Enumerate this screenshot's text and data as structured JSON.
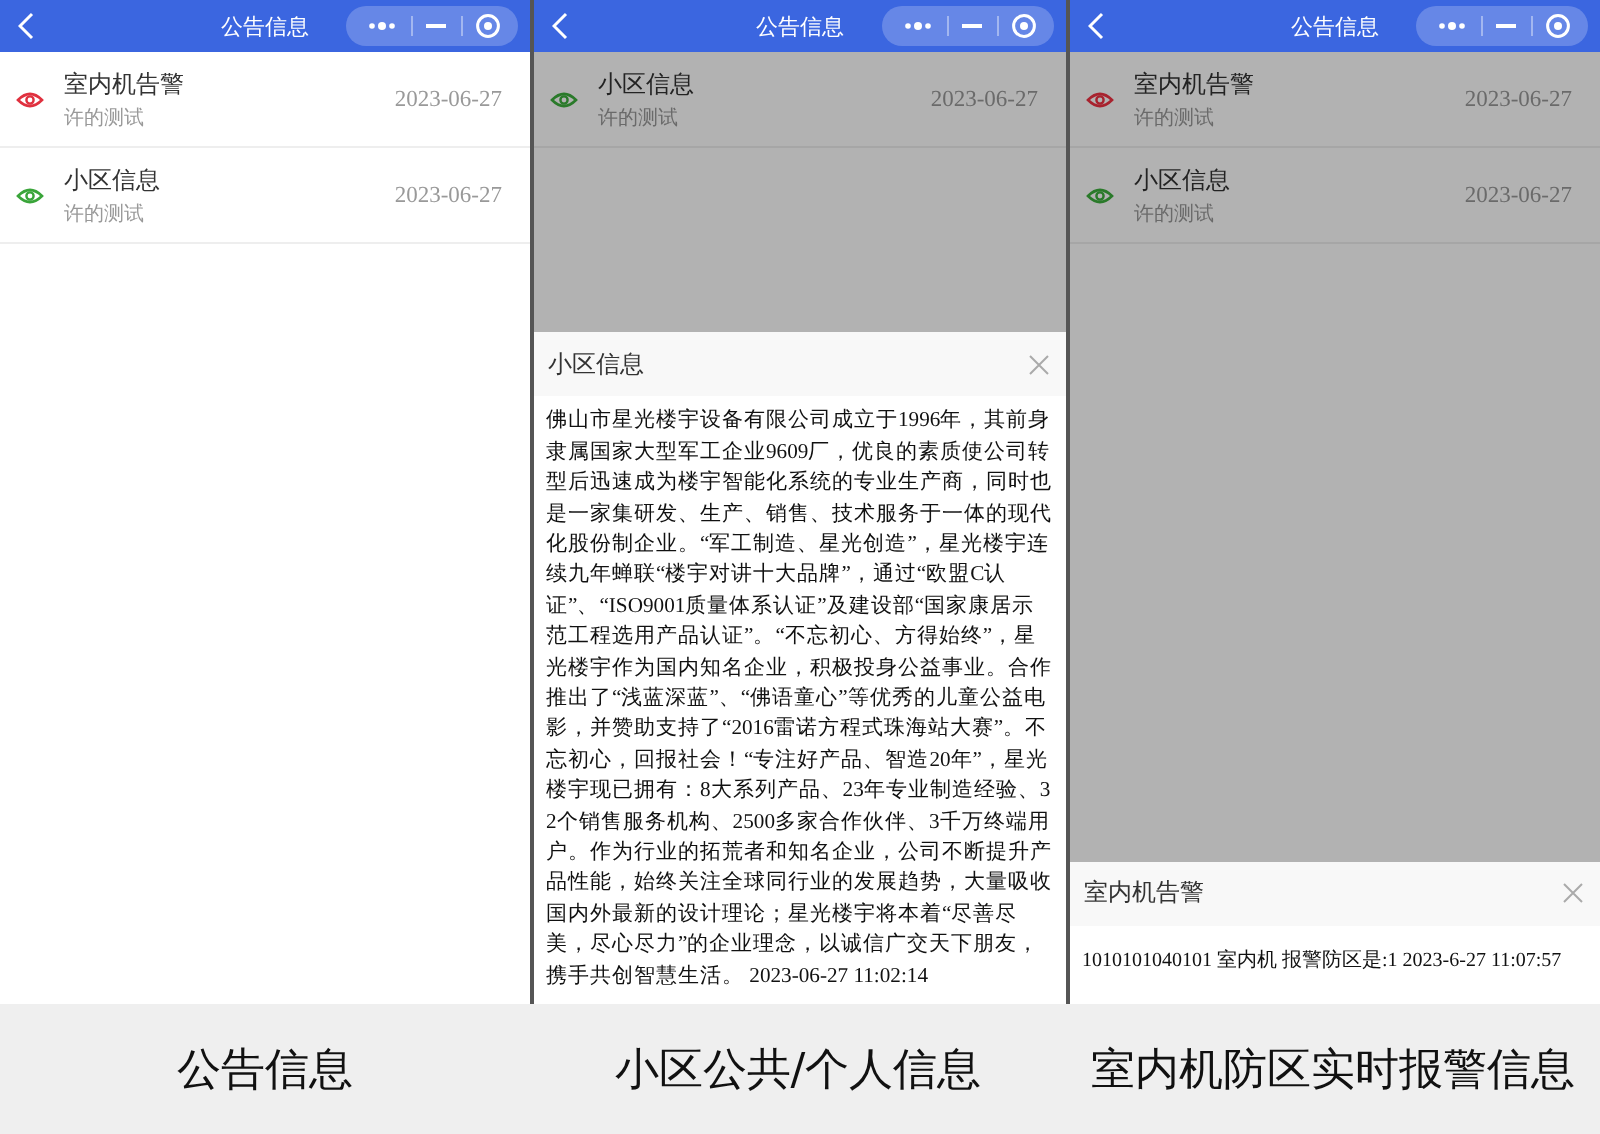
{
  "panels": [
    {
      "title": "公告信息",
      "items": [
        {
          "title": "室内机告警",
          "subtitle": "许的测试",
          "date": "2023-06-27",
          "color": "#e0313f"
        },
        {
          "title": "小区信息",
          "subtitle": "许的测试",
          "date": "2023-06-27",
          "color": "#3aa53a"
        }
      ],
      "caption": "公告信息"
    },
    {
      "title": "公告信息",
      "items": [
        {
          "title": "小区信息",
          "subtitle": "许的测试",
          "date": "2023-06-27",
          "color": "#2a7a2a"
        }
      ],
      "dialog": {
        "title": "小区信息",
        "body": "佛山市星光楼宇设备有限公司成立于1996年，其前身隶属国家大型军工企业9609厂，优良的素质使公司转型后迅速成为楼宇智能化系统的专业生产商，同时也是一家集研发、生产、销售、技术服务于一体的现代化股份制企业。“军工制造、星光创造”，星光楼宇连续九年蝉联“楼宇对讲十大品牌”，通过“欧盟C认证”、“ISO9001质量体系认证”及建设部“国家康居示范工程选用产品认证”。“不忘初心、方得始终”，星光楼宇作为国内知名企业，积极投身公益事业。合作推出了“浅蓝深蓝”、“佛语童心”等优秀的儿童公益电影，并赞助支持了“2016雷诺方程式珠海站大赛”。不忘初心，回报社会！“专注好产品、智造20年”，星光楼宇现已拥有：8大系列产品、23年专业制造经验、32个销售服务机构、2500多家合作伙伴、3千万终端用户。作为行业的拓荒者和知名企业，公司不断提升产品性能，始终关注全球同行业的发展趋势，大量吸收国内外最新的设计理论；星光楼宇将本着“尽善尽美，尽心尽力”的企业理念，以诚信广交天下朋友，携手共创智慧生活。 2023-06-27 11:02:14"
      },
      "caption": "小区公共/个人信息"
    },
    {
      "title": "公告信息",
      "items": [
        {
          "title": "室内机告警",
          "subtitle": "许的测试",
          "date": "2023-06-27",
          "color": "#a8222e"
        },
        {
          "title": "小区信息",
          "subtitle": "许的测试",
          "date": "2023-06-27",
          "color": "#2a7a2a"
        }
      ],
      "dialog": {
        "title": "室内机告警",
        "body": "1010101040101 室内机 报警防区是:1 2023-6-27 11:07:57"
      },
      "caption": "室内机防区实时报警信息"
    }
  ]
}
